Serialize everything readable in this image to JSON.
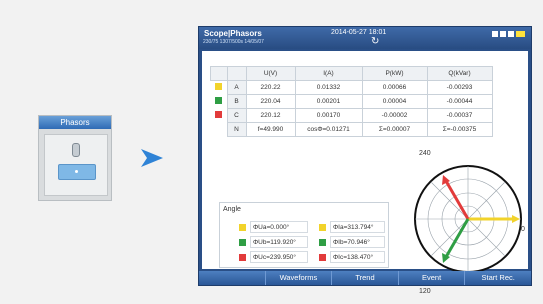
{
  "mini_panel": {
    "title": "Phasors"
  },
  "screen": {
    "title": "Scope|Phasors",
    "date": "2014-05-27 18:01",
    "sub": "230/75    1307/500s  14/05/07",
    "refresh_icon": "↻"
  },
  "table": {
    "headers": [
      "",
      "",
      "U(V)",
      "I(A)",
      "P(kW)",
      "Q(kVar)"
    ],
    "rows": [
      {
        "color": "#f2d32b",
        "label": "A",
        "u": "220.22",
        "i": "0.01332",
        "p": "0.00066",
        "q": "-0.00293"
      },
      {
        "color": "#2f9e44",
        "label": "B",
        "u": "220.04",
        "i": "0.00201",
        "p": "0.00004",
        "q": "-0.00044"
      },
      {
        "color": "#e23b3b",
        "label": "C",
        "u": "220.12",
        "i": "0.00170",
        "p": "-0.00002",
        "q": "-0.00037"
      }
    ],
    "total": {
      "label": "N",
      "u": "f=49.990",
      "i": "cosΦ=0.01271",
      "p": "Σ=0.00007",
      "q": "Σ=-0.00375"
    }
  },
  "angle_panel": {
    "title": "Angle",
    "items": [
      {
        "text": "ΦUa=0.000°",
        "color": "#f2d32b"
      },
      {
        "text": "ΦIa=313.794°",
        "color": "#f2d32b"
      },
      {
        "text": "ΦUb=119.920°",
        "color": "#2f9e44"
      },
      {
        "text": "ΦIb=70.946°",
        "color": "#2f9e44"
      },
      {
        "text": "ΦUc=239.950°",
        "color": "#e23b3b"
      },
      {
        "text": "ΦIc=138.470°",
        "color": "#e23b3b"
      }
    ]
  },
  "phasor_labels": {
    "a240": "240",
    "a120": "120",
    "a0": "0"
  },
  "bottom_bar": [
    "",
    "Waveforms",
    "Trend",
    "Event",
    "Start Rec."
  ],
  "colors": {
    "arrow": "#2f83d6",
    "titlebar": "#2a4f87"
  }
}
